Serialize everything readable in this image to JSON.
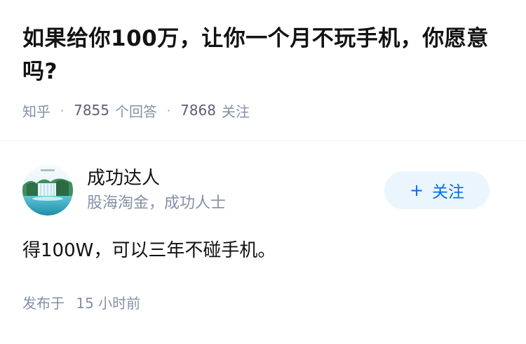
{
  "question": {
    "title": "如果给你100万，让你一个月不玩手机，你愿意吗?",
    "source": "知乎",
    "separator": "·",
    "answer_count": "7855",
    "answer_label": "个回答",
    "follow_count": "7868",
    "follow_label": "关注"
  },
  "answer": {
    "author_name": "成功达人",
    "author_bio": "股海淘金，成功人士",
    "follow_button_plus": "+",
    "follow_button_label": "关注",
    "content": "得100W，可以三年不碰手机。",
    "publish_prefix": "发布于",
    "publish_time": "15 小时前"
  },
  "colors": {
    "accent": "#056de8",
    "muted_text": "#8590a6",
    "button_bg": "#ebf5fd"
  },
  "icons": {
    "avatar": "waterfall-landscape-avatar"
  }
}
